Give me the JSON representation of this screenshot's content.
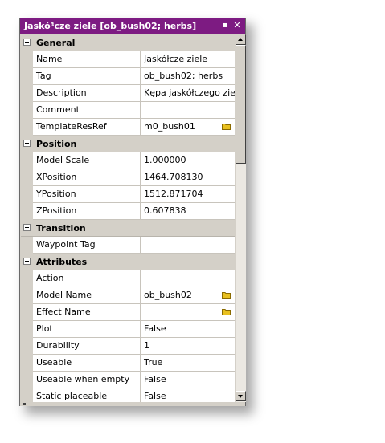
{
  "window": {
    "title": "Jaskó³cze ziele [ob_bush02; herbs]",
    "pin_glyph": "▪",
    "close_glyph": "✕"
  },
  "rows": [
    {
      "type": "category",
      "label": "General"
    },
    {
      "type": "property",
      "name": "Name",
      "value": "Jaskółcze ziele"
    },
    {
      "type": "property",
      "name": "Tag",
      "value": "ob_bush02; herbs"
    },
    {
      "type": "property",
      "name": "Description",
      "value": "Kępa jaskółczego ziela."
    },
    {
      "type": "property",
      "name": "Comment",
      "value": ""
    },
    {
      "type": "property",
      "name": "TemplateResRef",
      "value": "m0_bush01",
      "browse": true
    },
    {
      "type": "category",
      "label": "Position"
    },
    {
      "type": "property",
      "name": "Model Scale",
      "value": "1.000000"
    },
    {
      "type": "property",
      "name": "XPosition",
      "value": "1464.708130"
    },
    {
      "type": "property",
      "name": "YPosition",
      "value": "1512.871704"
    },
    {
      "type": "property",
      "name": "ZPosition",
      "value": "0.607838"
    },
    {
      "type": "category",
      "label": "Transition"
    },
    {
      "type": "property",
      "name": "Waypoint Tag",
      "value": ""
    },
    {
      "type": "category",
      "label": "Attributes"
    },
    {
      "type": "property",
      "name": "Action",
      "value": ""
    },
    {
      "type": "property",
      "name": "Model Name",
      "value": "ob_bush02",
      "browse": true
    },
    {
      "type": "property",
      "name": "Effect Name",
      "value": "",
      "browse": true
    },
    {
      "type": "property",
      "name": "Plot",
      "value": "False"
    },
    {
      "type": "property",
      "name": "Durability",
      "value": "1"
    },
    {
      "type": "property",
      "name": "Useable",
      "value": "True"
    },
    {
      "type": "property",
      "name": "Useable when empty",
      "value": "False"
    },
    {
      "type": "property",
      "name": "Static placeable",
      "value": "False"
    }
  ],
  "colors": {
    "titlebar": "#7d1b82",
    "category_bg": "#d4d0c8",
    "browse_icon": "#e8c020"
  },
  "scroll": {
    "position_fraction": 0.0,
    "visible_fraction": 0.33
  }
}
